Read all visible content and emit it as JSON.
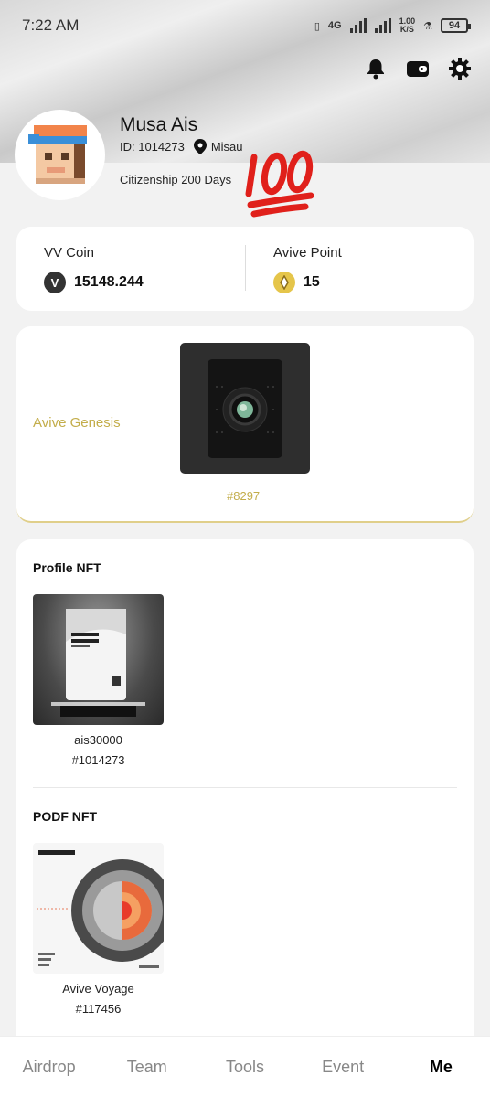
{
  "status_bar": {
    "time": "7:22 AM",
    "network": "4G",
    "speed_value": "1.00",
    "speed_unit": "K/S",
    "battery": "94"
  },
  "header_icons": [
    "bell-icon",
    "wallet-icon",
    "settings-gear-icon"
  ],
  "profile": {
    "name": "Musa Ais",
    "id_text": "ID: 1014273",
    "location": "Misau",
    "citizenship": "Citizenship 200 Days",
    "badge_emoji": "💯"
  },
  "balances": {
    "vv_coin_label": "VV Coin",
    "vv_coin_value": "15148.244",
    "vv_icon_glyph": "V",
    "avive_point_label": "Avive Point",
    "avive_point_value": "15"
  },
  "genesis": {
    "label": "Avive Genesis",
    "number": "#8297"
  },
  "nfts": {
    "profile_title": "Profile NFT",
    "profile_item_name": "ais30000",
    "profile_item_id": "#1014273",
    "podf_title": "PODF NFT",
    "podf_item_name": "Avive Voyage",
    "podf_item_id": "#117456"
  },
  "bottom_nav": [
    {
      "label": "Airdrop",
      "active": false
    },
    {
      "label": "Team",
      "active": false
    },
    {
      "label": "Tools",
      "active": false
    },
    {
      "label": "Event",
      "active": false
    },
    {
      "label": "Me",
      "active": true
    }
  ],
  "colors": {
    "accent_gold": "#c3ad4a",
    "point_coin": "#e5c54a",
    "hundred_red": "#e0201b"
  }
}
